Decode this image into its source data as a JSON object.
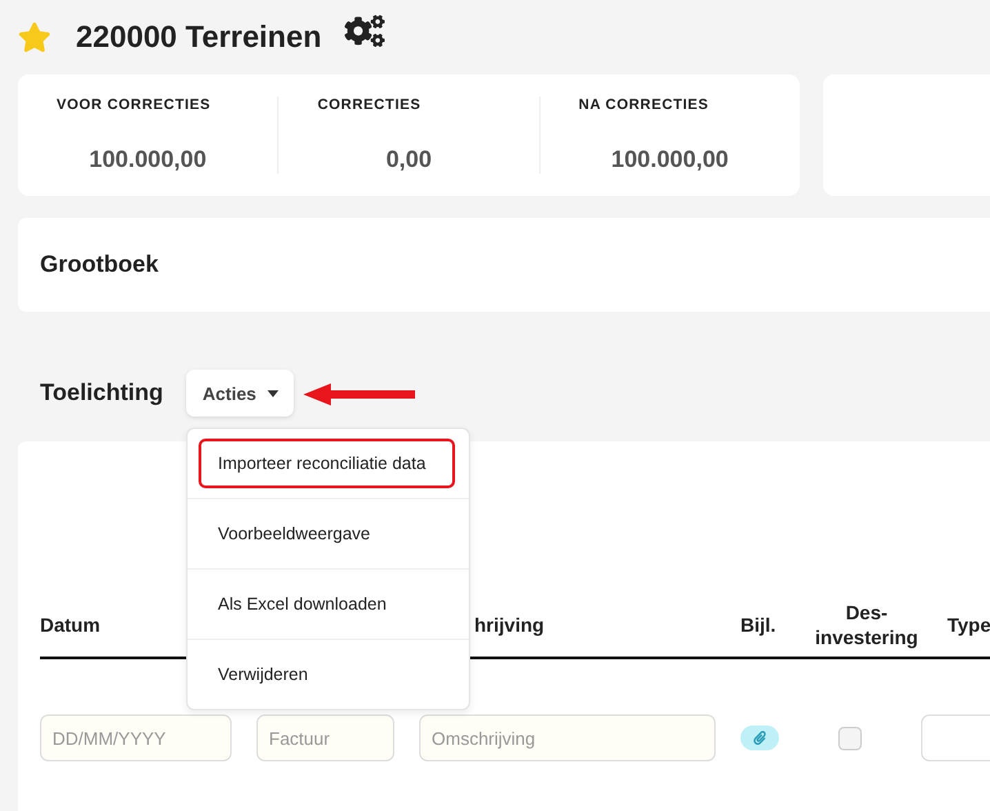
{
  "page": {
    "title": "220000 Terreinen",
    "favorite": true
  },
  "summary": [
    {
      "label": "VOOR CORRECTIES",
      "value": "100.000,00"
    },
    {
      "label": "CORRECTIES",
      "value": "0,00"
    },
    {
      "label": "NA CORRECTIES",
      "value": "100.000,00"
    }
  ],
  "ledger": {
    "title": "Grootboek"
  },
  "notes": {
    "title": "Toelichting",
    "actions_button": "Acties",
    "menu": [
      {
        "label": "Importeer reconciliatie data",
        "highlighted": true
      },
      {
        "label": "Voorbeeldweergave",
        "highlighted": false
      },
      {
        "label": "Als Excel downloaden",
        "highlighted": false
      },
      {
        "label": "Verwijderen",
        "highlighted": false
      }
    ],
    "columns": [
      {
        "label": "Datum"
      },
      {
        "label": "hrijving"
      },
      {
        "label": "Bijl."
      },
      {
        "label": "Des-\ninvestering"
      },
      {
        "label": "Type"
      }
    ],
    "row": {
      "date_placeholder": "DD/MM/YYYY",
      "invoice_placeholder": "Factuur",
      "description_placeholder": "Omschrijving",
      "divestment": false
    }
  }
}
